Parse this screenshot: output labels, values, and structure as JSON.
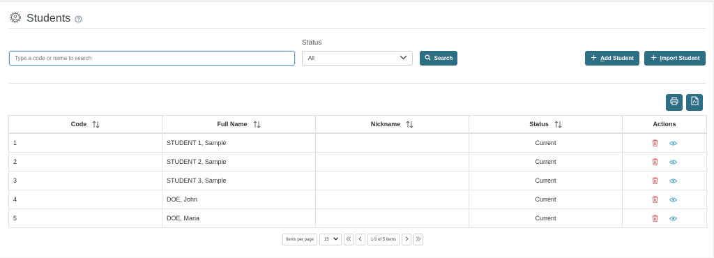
{
  "page": {
    "title": "Students",
    "icon": "gear-user-icon",
    "help_icon": "question-circle-icon"
  },
  "filters": {
    "search_placeholder": "Type a code or name to search",
    "status_label": "Status",
    "status_value": "All",
    "search_button": "Search"
  },
  "actions": {
    "add_student": "Add Student",
    "add_student_rest": "dd Student",
    "add_student_accesskey": "A",
    "import_student": "Import Student",
    "import_student_rest": "mport Student",
    "import_student_accesskey": "I",
    "print_icon": "printer-icon",
    "export_icon": "pdf-file-icon"
  },
  "table": {
    "columns": [
      "Code",
      "Full Name",
      "Nickname",
      "Status",
      "Actions"
    ],
    "rows": [
      {
        "code": "1",
        "full_name": "STUDENT 1, Sample",
        "nickname": "",
        "status": "Current"
      },
      {
        "code": "2",
        "full_name": "STUDENT 2, Sample",
        "nickname": "",
        "status": "Current"
      },
      {
        "code": "3",
        "full_name": "STUDENT 3, Sample",
        "nickname": "",
        "status": "Current"
      },
      {
        "code": "4",
        "full_name": "DOE, John",
        "nickname": "",
        "status": "Current"
      },
      {
        "code": "5",
        "full_name": "DOE, Maria",
        "nickname": "",
        "status": "Current"
      }
    ],
    "row_action_icons": [
      "trash-icon",
      "eye-icon"
    ]
  },
  "pagination": {
    "items_per_page_label": "Items per page",
    "items_per_page_value": "15",
    "range_label": "1-5 of 5 items"
  },
  "colors": {
    "primary": "#2f6f85",
    "delete": "#e05555",
    "view": "#4aa3c8"
  }
}
